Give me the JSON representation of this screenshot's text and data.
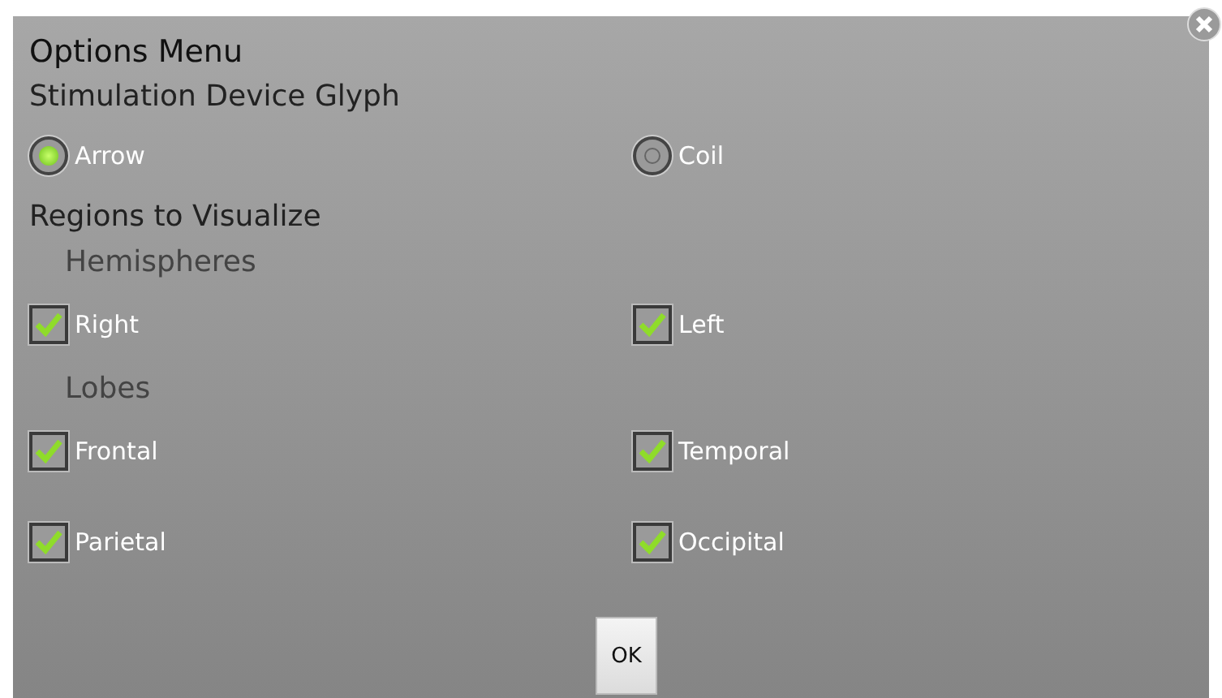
{
  "dialog": {
    "title": "Options Menu",
    "ok_button": "OK"
  },
  "glyph": {
    "heading": "Stimulation Device Glyph",
    "options": [
      {
        "label": "Arrow",
        "selected": true
      },
      {
        "label": "Coil",
        "selected": false
      }
    ]
  },
  "regions": {
    "heading": "Regions to Visualize",
    "groups": [
      {
        "heading": "Hemispheres",
        "items": [
          {
            "label": "Right",
            "checked": true
          },
          {
            "label": "Left",
            "checked": true
          }
        ]
      },
      {
        "heading": "Lobes",
        "items": [
          {
            "label": "Frontal",
            "checked": true
          },
          {
            "label": "Temporal",
            "checked": true
          },
          {
            "label": "Parietal",
            "checked": true
          },
          {
            "label": "Occipital",
            "checked": true
          }
        ]
      }
    ]
  }
}
